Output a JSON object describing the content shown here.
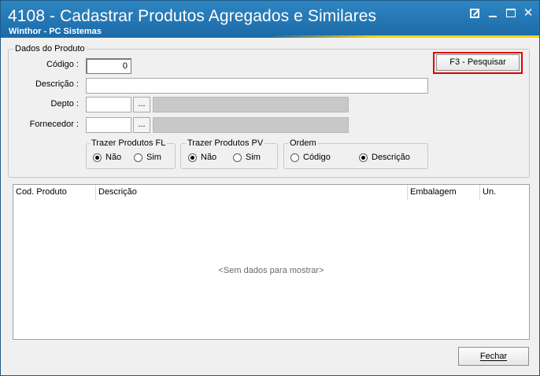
{
  "window": {
    "title": "4108 - Cadastrar Produtos Agregados e Similares",
    "subtitle": "Winthor - PC Sistemas"
  },
  "product_group": {
    "legend": "Dados do Produto",
    "codigo_label": "Código :",
    "codigo_value": "0",
    "descricao_label": "Descrição :",
    "descricao_value": "",
    "depto_label": "Depto :",
    "depto_value": "",
    "depto_name": "",
    "fornecedor_label": "Fornecedor :",
    "fornecedor_value": "",
    "fornecedor_name": "",
    "lookup_label": "...",
    "search_button": "F3 - Pesquisar"
  },
  "trazer_fl": {
    "legend": "Trazer Produtos FL",
    "options": [
      "Não",
      "Sim"
    ],
    "selected": "Não"
  },
  "trazer_pv": {
    "legend": "Trazer Produtos PV",
    "options": [
      "Não",
      "Sim"
    ],
    "selected": "Não"
  },
  "ordem": {
    "legend": "Ordem",
    "options": [
      "Código",
      "Descrição"
    ],
    "selected": "Descrição"
  },
  "grid": {
    "columns": [
      "Cod. Produto",
      "Descrição",
      "Embalagem",
      "Un."
    ],
    "empty_message": "<Sem dados para mostrar>"
  },
  "footer": {
    "close_button": "Fechar"
  }
}
